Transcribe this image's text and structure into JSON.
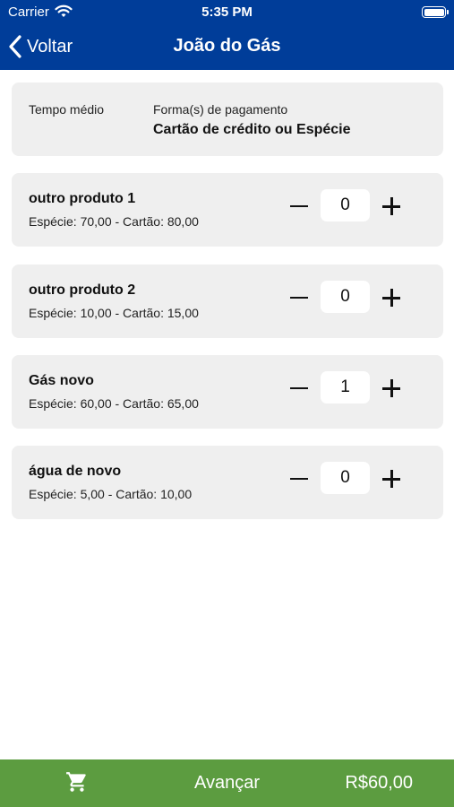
{
  "status": {
    "carrier": "Carrier",
    "time": "5:35 PM"
  },
  "nav": {
    "back_label": "Voltar",
    "title": "João do Gás"
  },
  "info": {
    "tempo_label": "Tempo médio",
    "payment_label": "Forma(s) de pagamento",
    "payment_value": "Cartão de crédito ou Espécie"
  },
  "products": [
    {
      "name": "outro produto 1",
      "price": "Espécie: 70,00 - Cartão: 80,00",
      "qty": "0"
    },
    {
      "name": "outro produto 2",
      "price": "Espécie: 10,00 - Cartão: 15,00",
      "qty": "0"
    },
    {
      "name": "Gás novo",
      "price": "Espécie: 60,00 - Cartão: 65,00",
      "qty": "1"
    },
    {
      "name": "água de novo",
      "price": "Espécie: 5,00 - Cartão: 10,00",
      "qty": "0"
    }
  ],
  "footer": {
    "advance_label": "Avançar",
    "total": "R$60,00",
    "cart_icon": "shopping-cart-icon"
  },
  "colors": {
    "nav": "#003d99",
    "footer": "#5c9c40",
    "card": "#efefef"
  }
}
